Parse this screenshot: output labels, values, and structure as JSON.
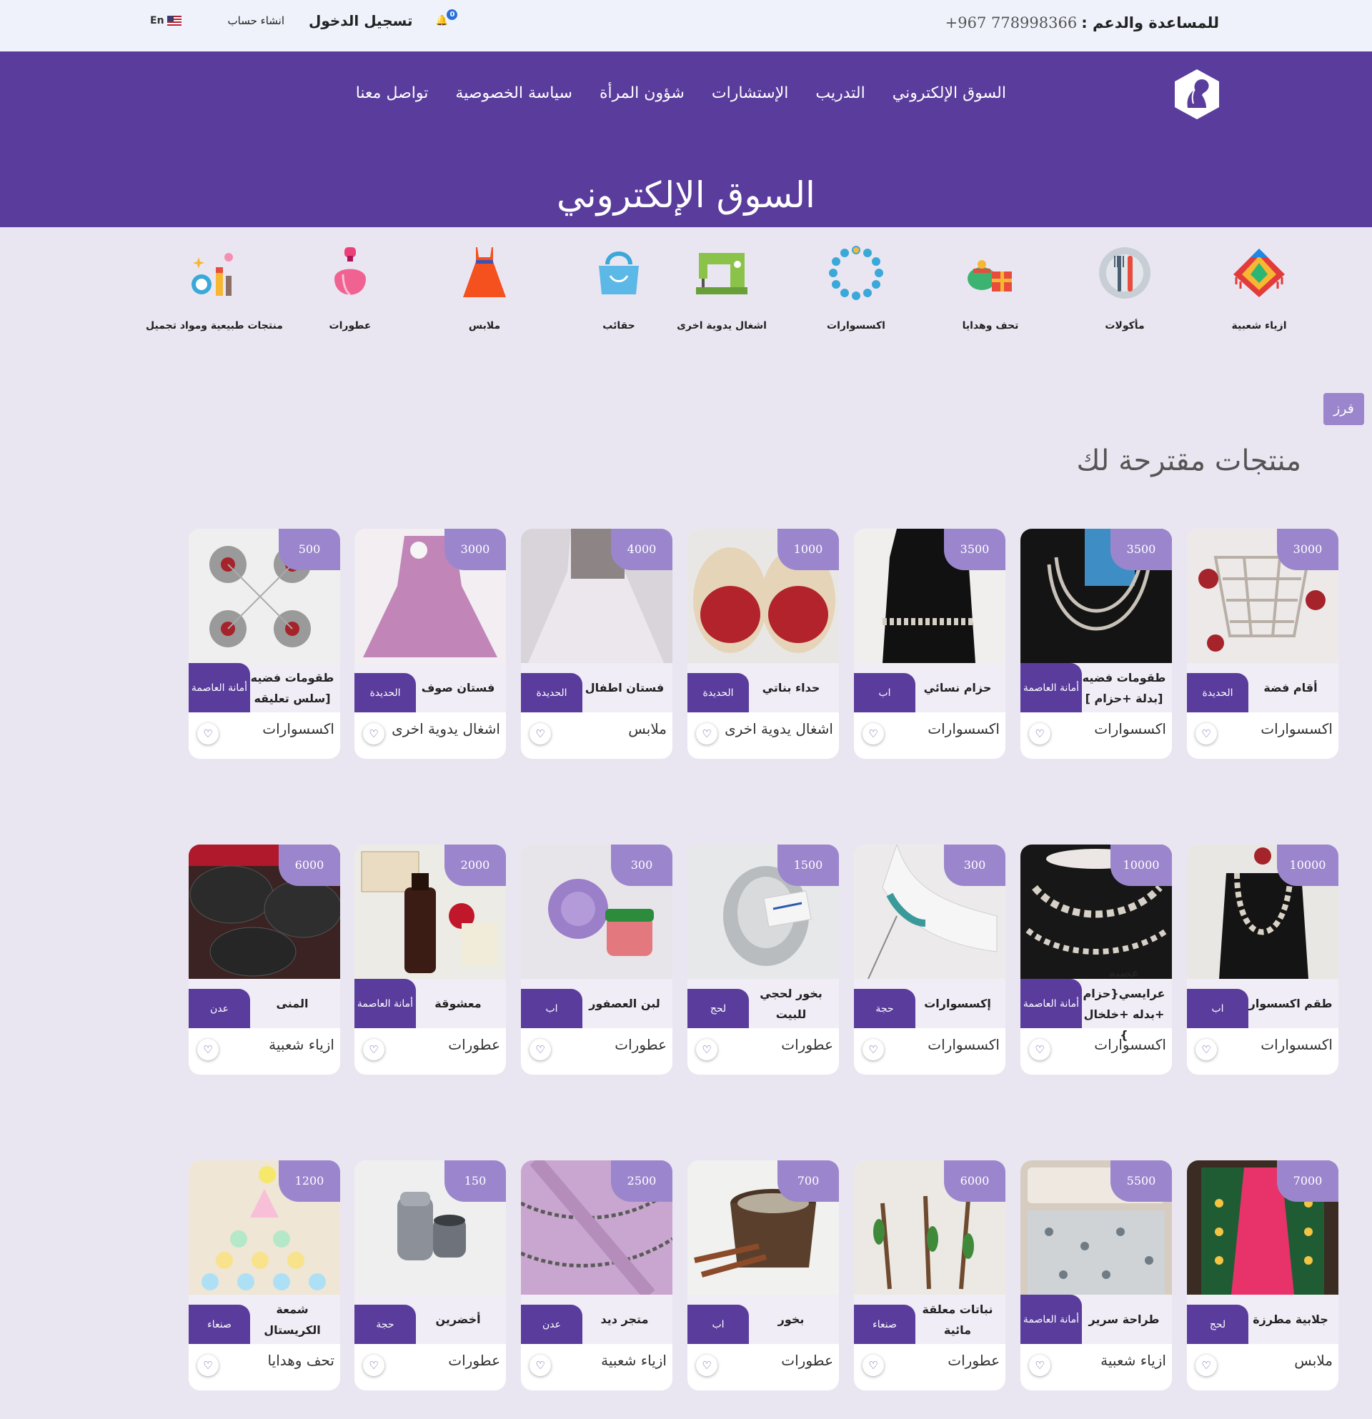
{
  "topbar": {
    "support_label": "للمساعدة والدعم :",
    "phone": "+967 778998366",
    "login": "تسجيل الدخول",
    "signup": "انشاء حساب",
    "lang": "En",
    "notifications": "0"
  },
  "nav": [
    "السوق الإلكتروني",
    "التدريب",
    "الإستشارات",
    "شؤون المرأة",
    "سياسة الخصوصية",
    "تواصل معنا"
  ],
  "page_title": "السوق الإلكتروني",
  "categories": [
    "ازياء شعبية",
    "مأكولات",
    "تحف وهدايا",
    "اكسسوارات",
    "اشغال يدوية اخرى",
    "حقائب",
    "ملابس",
    "عطورات",
    "منتجات طبيعية ومواد تجميل"
  ],
  "sort_label": "فرز",
  "section_title": "منتجات مقترحة لك",
  "products": [
    {
      "price": "3000",
      "name": "أقام فضة",
      "location": "الحديدة",
      "category": "اكسسوارات"
    },
    {
      "price": "3500",
      "name": "طقومات فضيه [بدلة +حزام ]",
      "location": "أمانة العاصمة",
      "category": "اكسسوارات"
    },
    {
      "price": "3500",
      "name": "حزام نسائي",
      "location": "اب",
      "category": "اكسسوارات"
    },
    {
      "price": "1000",
      "name": "حداء بناتي",
      "location": "الحديدة",
      "category": "اشغال يدوية اخرى"
    },
    {
      "price": "4000",
      "name": "فستان اطفال",
      "location": "الحديدة",
      "category": "ملابس"
    },
    {
      "price": "3000",
      "name": "فستان صوف",
      "location": "الحديدة",
      "category": "اشغال يدوية اخرى"
    },
    {
      "price": "500",
      "name": "طقومات فضيه [سلس تعليقه",
      "location": "أمانة العاصمة",
      "category": "اكسسوارات"
    },
    {
      "price": "10000",
      "name": "طقم اكسسوار",
      "location": "اب",
      "category": "اكسسوارات"
    },
    {
      "price": "10000",
      "name": "عصبه عرايسي{حزام +بدله +خلخال }",
      "location": "أمانة العاصمة",
      "category": "اكسسوارات"
    },
    {
      "price": "300",
      "name": "إكسسوارات",
      "location": "حجة",
      "category": "اكسسوارات"
    },
    {
      "price": "1500",
      "name": "بخور لحجي للبيت",
      "location": "لحج",
      "category": "عطورات"
    },
    {
      "price": "300",
      "name": "لبن العصفور",
      "location": "اب",
      "category": "عطورات"
    },
    {
      "price": "2000",
      "name": "معشوقة",
      "location": "أمانة العاصمة",
      "category": "عطورات"
    },
    {
      "price": "6000",
      "name": "المنى",
      "location": "عدن",
      "category": "ازياء شعبية"
    },
    {
      "price": "7000",
      "name": "جلابية مطرزة",
      "location": "لحج",
      "category": "ملابس"
    },
    {
      "price": "5500",
      "name": "طراحة سرير",
      "location": "أمانة العاصمة",
      "category": "ازياء شعبية"
    },
    {
      "price": "6000",
      "name": "نباتات معلقة مائية",
      "location": "صنعاء",
      "category": "عطورات"
    },
    {
      "price": "700",
      "name": "بخور",
      "location": "اب",
      "category": "عطورات"
    },
    {
      "price": "2500",
      "name": "متجر ديد",
      "location": "عدن",
      "category": "ازياء شعبية"
    },
    {
      "price": "150",
      "name": "أخضرين",
      "location": "حجة",
      "category": "عطورات"
    },
    {
      "price": "1200",
      "name": "شمعة الكريستال",
      "location": "صنعاء",
      "category": "تحف وهدايا"
    }
  ]
}
